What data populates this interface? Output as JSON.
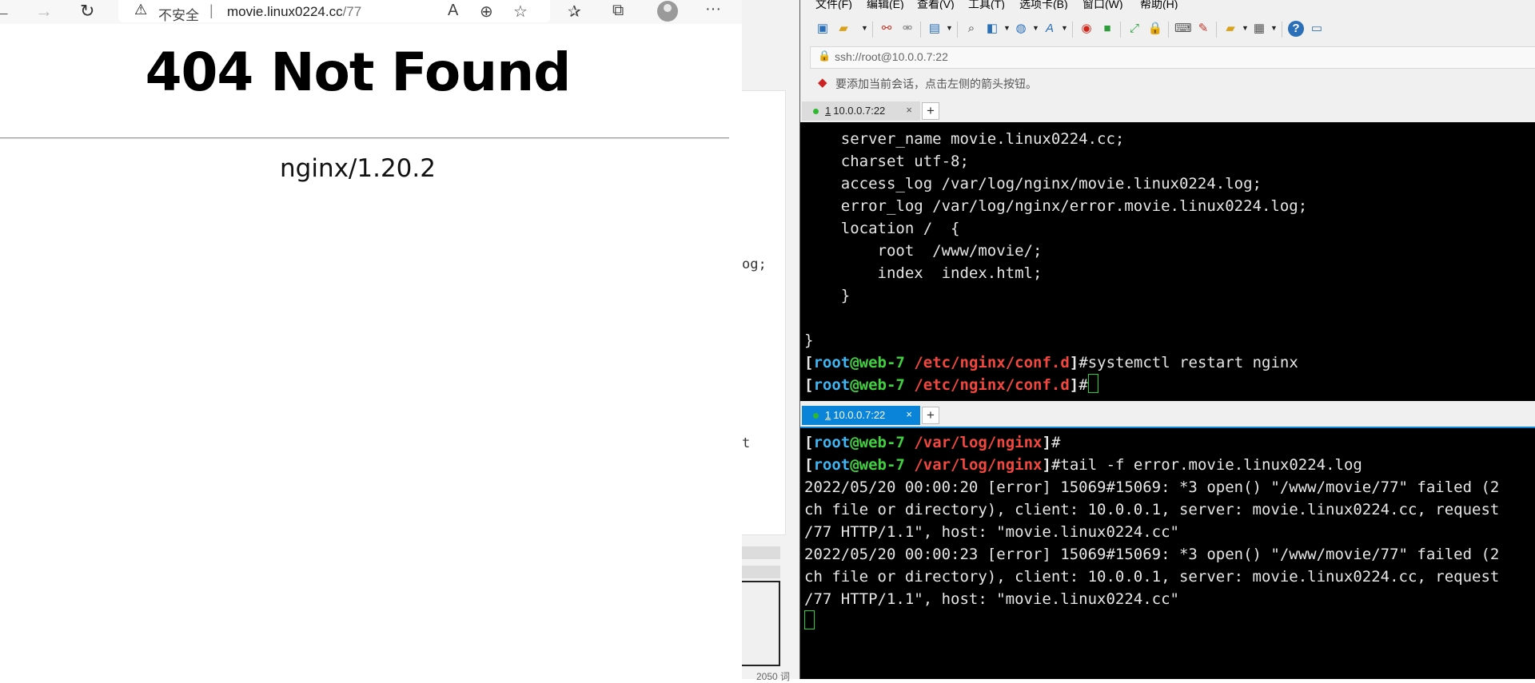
{
  "browser": {
    "security_label": "不安全",
    "separator": "|",
    "url_host": "movie.linux0224.cc",
    "url_path": "/77",
    "page_heading": "404 Not Found",
    "page_server": "nginx/1.20.2"
  },
  "background_window": {
    "fragment_1": "og;",
    "fragment_2": "t",
    "word_count": "2050 词"
  },
  "xshell": {
    "menu": [
      "文件(F)",
      "编辑(E)",
      "查看(V)",
      "工具(T)",
      "选项卡(B)",
      "窗口(W)",
      "帮助(H)"
    ],
    "address_text": "ssh://root@10.0.0.7:22",
    "hint_text": "要添加当前会话，点击左侧的箭头按钮。",
    "tab_top": {
      "num": "1",
      "label": "10.0.0.7:22",
      "close": "×"
    },
    "tab_bottom": {
      "num": "1",
      "label": "10.0.0.7:22",
      "close": "×"
    },
    "new_tab": "+",
    "accent_color": "#0a84d8"
  },
  "terminal_top": {
    "lines": [
      "    server_name movie.linux0224.cc;",
      "    charset utf-8;",
      "    access_log /var/log/nginx/movie.linux0224.log;",
      "    error_log /var/log/nginx/error.movie.linux0224.log;",
      "    location /  {",
      "        root  /www/movie/;",
      "        index  index.html;",
      "    }",
      "",
      "}"
    ],
    "prompt_user": "root",
    "prompt_host": "web-7",
    "prompt_dir": "/etc/nginx/conf.d",
    "command_1": "#systemctl restart nginx",
    "command_2": "#"
  },
  "terminal_bottom": {
    "prompt_user": "root",
    "prompt_host": "web-7",
    "prompt_dir": "/var/log/nginx",
    "command_1": "#",
    "command_2": "#tail -f error.movie.linux0224.log",
    "log_lines": [
      "2022/05/20 00:00:20 [error] 15069#15069: *3 open() \"/www/movie/77\" failed (2",
      "ch file or directory), client: 10.0.0.1, server: movie.linux0224.cc, request",
      "/77 HTTP/1.1\", host: \"movie.linux0224.cc\"",
      "2022/05/20 00:00:23 [error] 15069#15069: *3 open() \"/www/movie/77\" failed (2",
      "ch file or directory), client: 10.0.0.1, server: movie.linux0224.cc, request",
      "/77 HTTP/1.1\", host: \"movie.linux0224.cc\""
    ]
  }
}
